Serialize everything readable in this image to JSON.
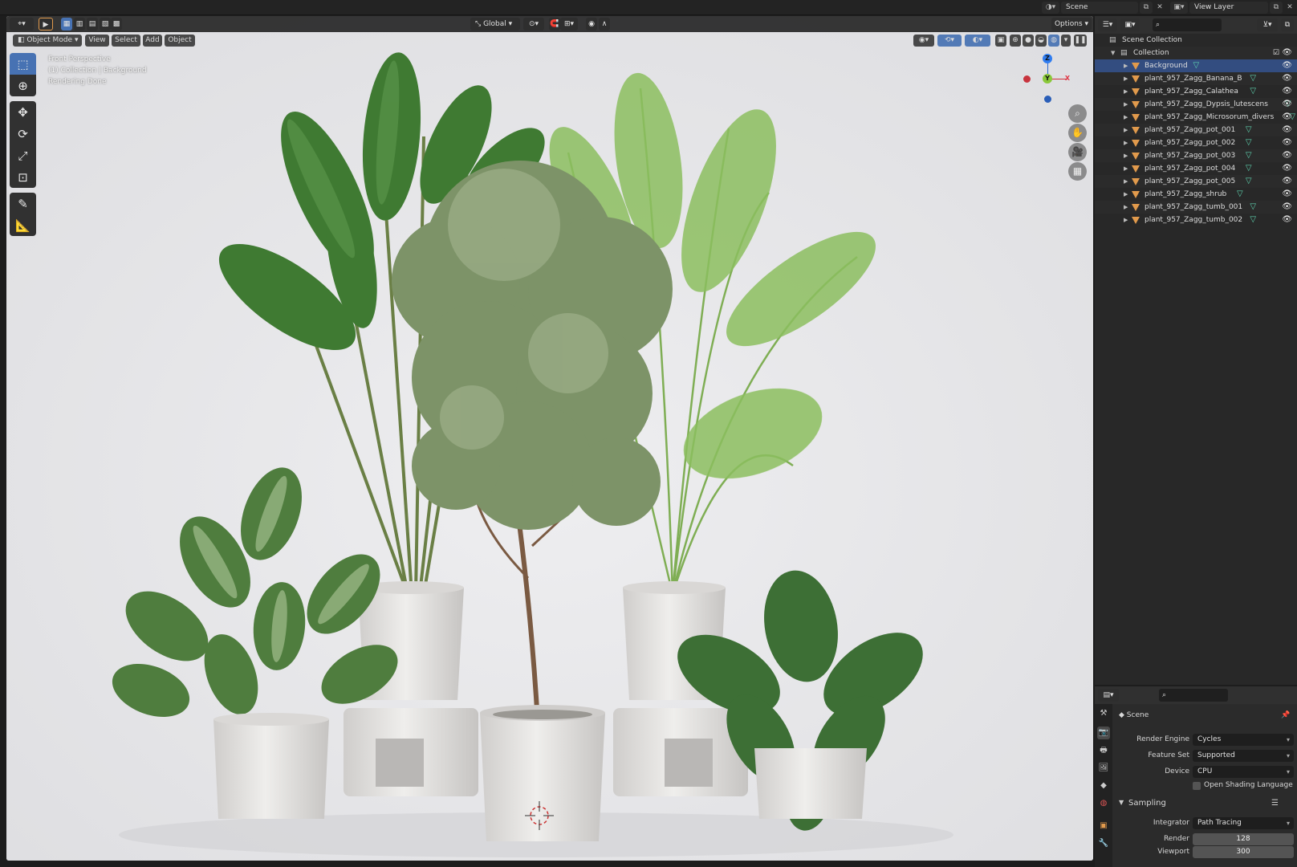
{
  "topbar": {
    "scene_label": "Scene",
    "view_layer_label": "View Layer"
  },
  "viewport_header": {
    "transform_orientation": "Global",
    "options_label": "Options"
  },
  "viewport_menus": {
    "mode": "Object Mode",
    "view": "View",
    "select": "Select",
    "add": "Add",
    "object": "Object"
  },
  "viewport_overlay": {
    "line1": "Front Perspective",
    "line2": "(1) Collection | Background",
    "line3": "Rendering Done"
  },
  "gizmo": {
    "z": "Z",
    "y": "Y",
    "x": "X"
  },
  "outliner": {
    "scene_collection": "Scene Collection",
    "collection": "Collection",
    "items": [
      {
        "name": "Background",
        "selected": true
      },
      {
        "name": "plant_957_Zagg_Banana_B"
      },
      {
        "name": "plant_957_Zagg_Calathea"
      },
      {
        "name": "plant_957_Zagg_Dypsis_lutescens"
      },
      {
        "name": "plant_957_Zagg_Microsorum_divers"
      },
      {
        "name": "plant_957_Zagg_pot_001"
      },
      {
        "name": "plant_957_Zagg_pot_002"
      },
      {
        "name": "plant_957_Zagg_pot_003"
      },
      {
        "name": "plant_957_Zagg_pot_004"
      },
      {
        "name": "plant_957_Zagg_pot_005"
      },
      {
        "name": "plant_957_Zagg_shrub"
      },
      {
        "name": "plant_957_Zagg_tumb_001"
      },
      {
        "name": "plant_957_Zagg_tumb_002"
      }
    ]
  },
  "properties": {
    "context": "Scene",
    "render_engine_label": "Render Engine",
    "render_engine_value": "Cycles",
    "feature_set_label": "Feature Set",
    "feature_set_value": "Supported",
    "device_label": "Device",
    "device_value": "CPU",
    "osl_label": "Open Shading Language",
    "sampling_label": "Sampling",
    "integrator_label": "Integrator",
    "integrator_value": "Path Tracing",
    "render_label": "Render",
    "render_value": "128",
    "viewport_label": "Viewport",
    "viewport_value": "300"
  },
  "colors": {
    "accent": "#4772b3",
    "selection": "#334d80",
    "object_icon": "#e19a4c",
    "mesh_icon": "#5fd4b0",
    "viewport_bg": "#e7e7e9"
  }
}
